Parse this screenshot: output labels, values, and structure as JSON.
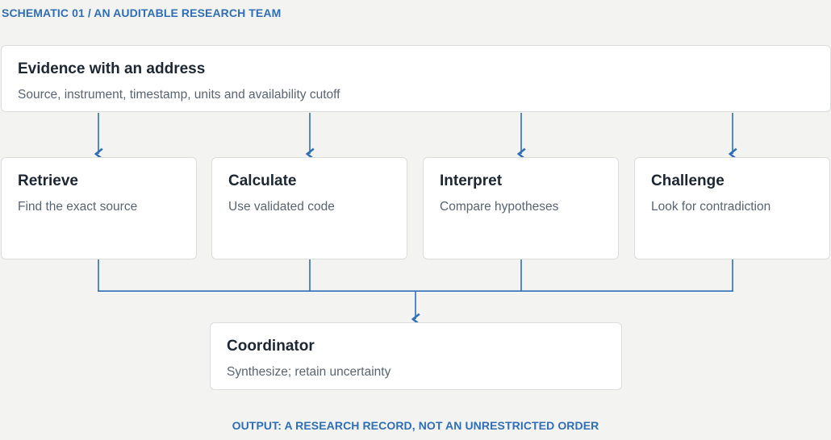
{
  "header": {
    "kicker": "SCHEMATIC 01 / AN AUDITABLE RESEARCH TEAM"
  },
  "evidence": {
    "title": "Evidence with an address",
    "subtitle": "Source, instrument, timestamp, units and availability cutoff"
  },
  "agents": [
    {
      "title": "Retrieve",
      "subtitle": "Find the exact source"
    },
    {
      "title": "Calculate",
      "subtitle": "Use validated code"
    },
    {
      "title": "Interpret",
      "subtitle": "Compare hypotheses"
    },
    {
      "title": "Challenge",
      "subtitle": "Look for contradiction"
    }
  ],
  "coordinator": {
    "title": "Coordinator",
    "subtitle": "Synthesize; retain uncertainty"
  },
  "footer": {
    "caption": "OUTPUT: A RESEARCH RECORD, NOT AN UNRESTRICTED ORDER"
  },
  "colors": {
    "accent": "#2f6eb8",
    "background": "#f3f3f1",
    "card": "#ffffff",
    "text": "#1d2633",
    "muted": "#5a6472"
  }
}
